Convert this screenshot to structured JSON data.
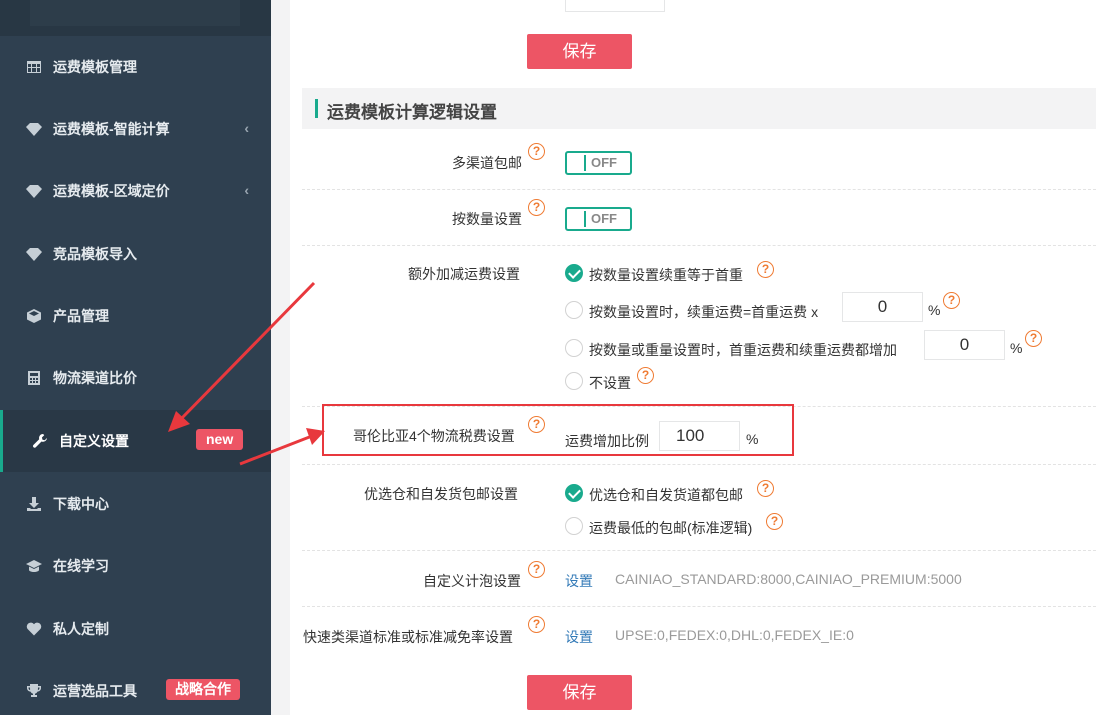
{
  "sidebar": {
    "items": [
      {
        "label": "运费模板管理",
        "icon": "table-icon"
      },
      {
        "label": "运费模板-智能计算",
        "icon": "diamond-icon",
        "chevron": "‹"
      },
      {
        "label": "运费模板-区域定价",
        "icon": "diamond-icon",
        "chevron": "‹"
      },
      {
        "label": "竞品模板导入",
        "icon": "diamond-icon"
      },
      {
        "label": "产品管理",
        "icon": "cube-icon"
      },
      {
        "label": "物流渠道比价",
        "icon": "calculator-icon"
      },
      {
        "label": "自定义设置",
        "icon": "wrench-icon",
        "badge": "new"
      },
      {
        "label": "下载中心",
        "icon": "download-icon"
      },
      {
        "label": "在线学习",
        "icon": "graduation-cap-icon"
      },
      {
        "label": "私人定制",
        "icon": "heart-icon"
      },
      {
        "label": "运营选品工具",
        "icon": "trophy-icon",
        "badge": "战略合作"
      }
    ]
  },
  "main": {
    "save_label": "保存",
    "section_title": "运费模板计算逻辑设置",
    "help_glyph": "?",
    "multi_channel": {
      "label": "多渠道包邮",
      "toggle": "OFF"
    },
    "by_quantity": {
      "label": "按数量设置",
      "toggle": "OFF"
    },
    "extra": {
      "label": "额外加减运费设置",
      "opt1": "按数量设置续重等于首重",
      "opt2": "按数量设置时，续重运费=首重运费 x",
      "opt2_value": "0",
      "opt3": "按数量或重量设置时，首重运费和续重运费都增加",
      "opt3_value": "0",
      "opt4": "不设置",
      "percent": "%"
    },
    "colombia": {
      "label": "哥伦比亚4个物流税费设置",
      "field_label": "运费增加比例",
      "value": "100",
      "percent": "%"
    },
    "preferred": {
      "label": "优选仓和自发货包邮设置",
      "opt1": "优选仓和自发货道都包邮",
      "opt2": "运费最低的包邮(标准逻辑)"
    },
    "bubble": {
      "label": "自定义计泡设置",
      "link": "设置",
      "value": "CAINIAO_STANDARD:8000,CAINIAO_PREMIUM:5000"
    },
    "express": {
      "label": "快速类渠道标准或标准减免率设置",
      "link": "设置",
      "value": "UPSE:0,FEDEX:0,DHL:0,FEDEX_IE:0"
    }
  },
  "colors": {
    "sidebar_bg": "#2f4050",
    "accent": "#19aa8d",
    "danger": "#ed5565",
    "highlight": "#e8383d",
    "help": "#ef7b33"
  }
}
